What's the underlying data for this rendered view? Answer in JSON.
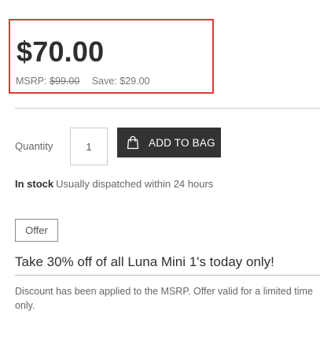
{
  "pricing": {
    "price": "$70.00",
    "msrp_label": "MSRP:",
    "msrp_value": "$99.00",
    "save_text": "Save: $29.00"
  },
  "purchase": {
    "quantity_label": "Quantity",
    "quantity_value": "1",
    "add_to_bag_label": "ADD TO BAG",
    "bag_icon": "shopping-bag-icon"
  },
  "stock": {
    "status": "In stock",
    "dispatch_note": "Usually dispatched within 24 hours"
  },
  "offer": {
    "tag": "Offer",
    "title": "Take 30% off of all Luna Mini 1's today only!",
    "description": "Discount has been applied to the MSRP. Offer valid for a limited time only."
  },
  "colors": {
    "highlight_border": "#e0393b",
    "button_bg": "#333333"
  }
}
